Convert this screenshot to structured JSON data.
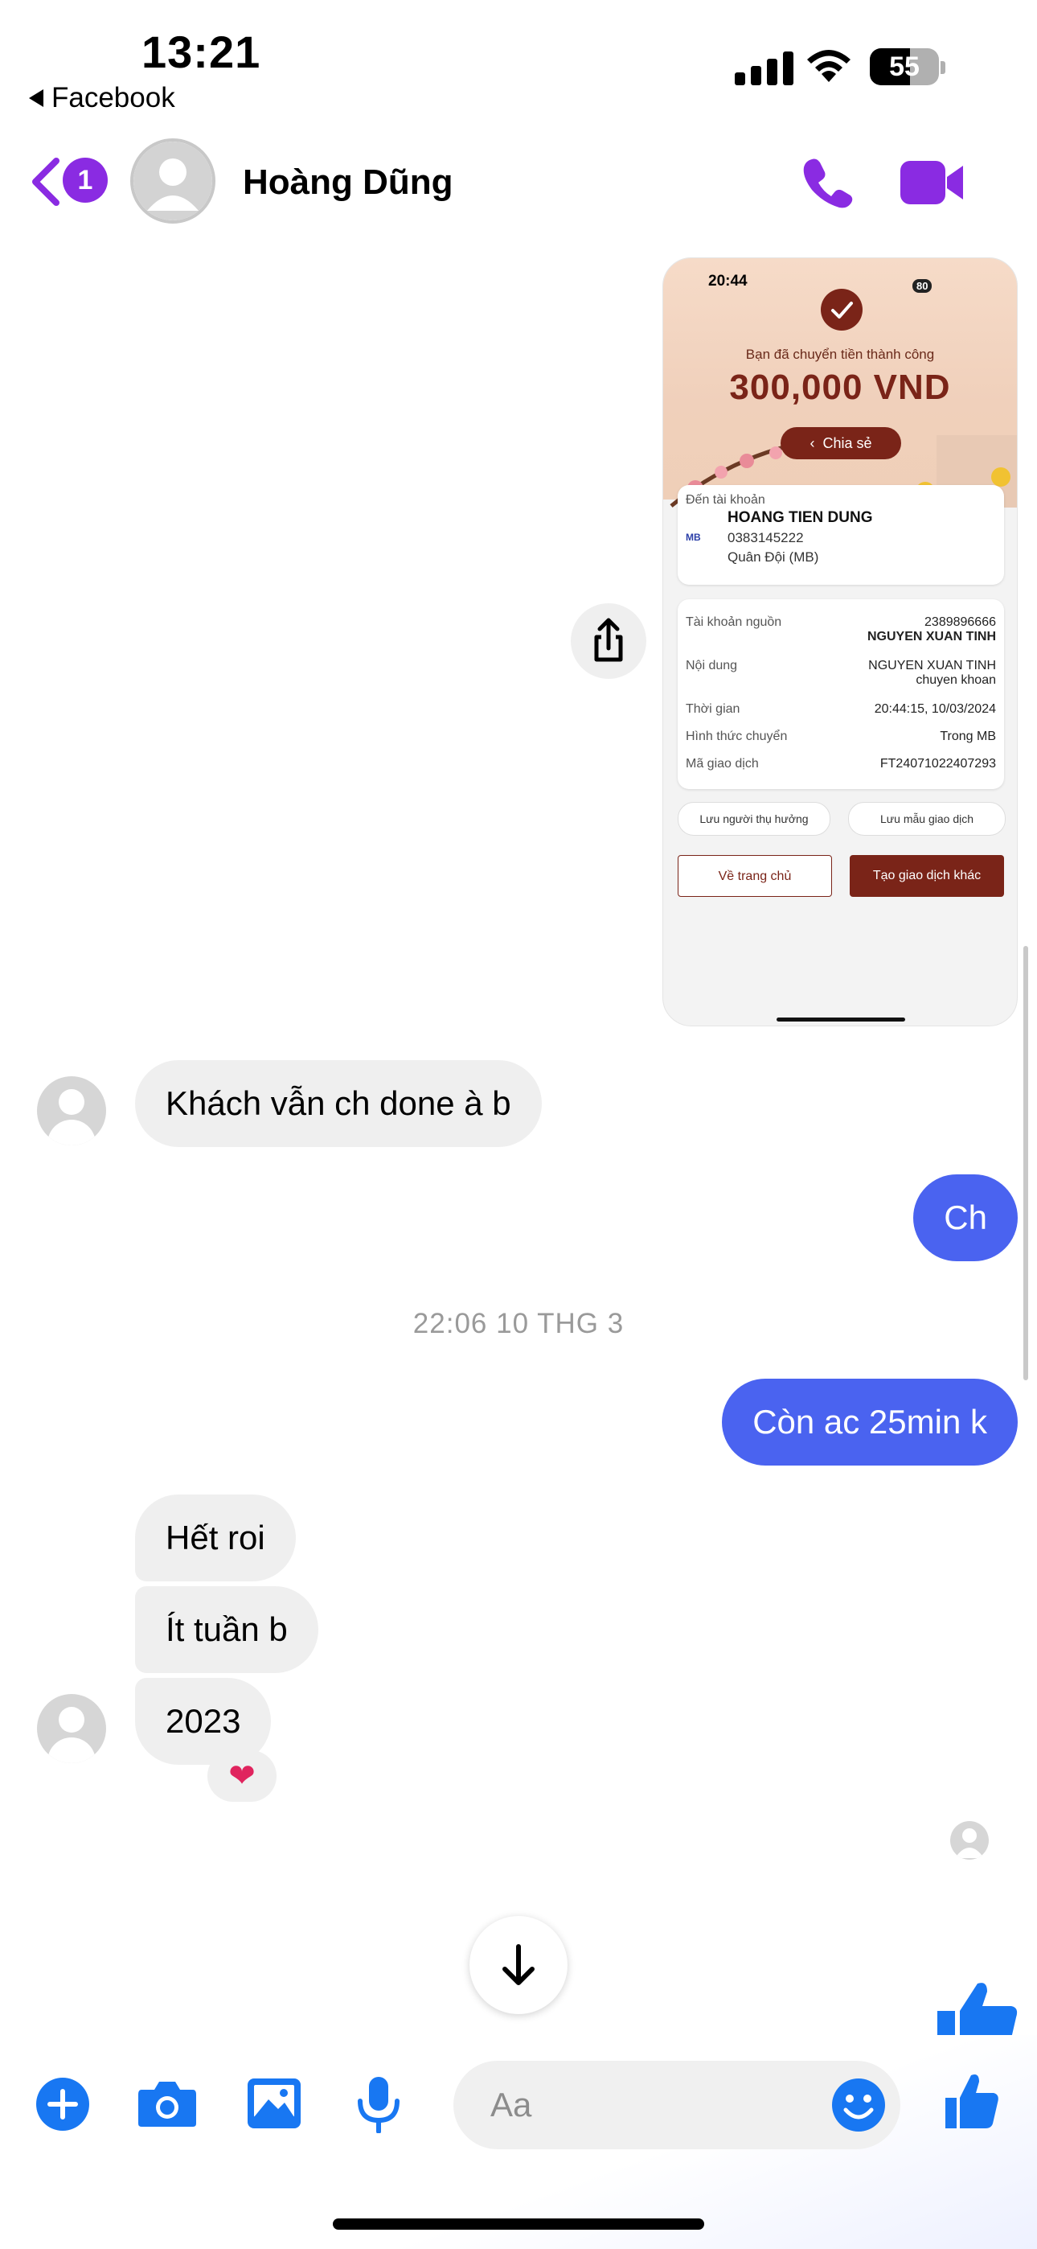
{
  "status_bar": {
    "time": "13:21",
    "back_app": "Facebook",
    "battery": "55"
  },
  "header": {
    "unread_count": "1",
    "contact_name": "Hoàng Dũng"
  },
  "shared_image": {
    "time": "20:44",
    "battery": "80",
    "title": "Bạn đã chuyển tiền thành công",
    "amount": "300,000 VND",
    "share_label": "Chia sẻ",
    "to_account_label": "Đến tài khoản",
    "bank_logo": "MB",
    "recipient_name": "HOANG TIEN DUNG",
    "recipient_account": "0383145222",
    "recipient_bank": "Quân Đội (MB)",
    "details": [
      {
        "label": "Tài khoản nguồn",
        "value": "2389896666",
        "value2": "NGUYEN XUAN TINH"
      },
      {
        "label": "Nội dung",
        "value": "NGUYEN XUAN TINH",
        "value2": "chuyen khoan"
      },
      {
        "label": "Thời gian",
        "value": "20:44:15, 10/03/2024"
      },
      {
        "label": "Hình thức chuyển",
        "value": "Trong MB"
      },
      {
        "label": "Mã giao dịch",
        "value": "FT24071022407293"
      }
    ],
    "save_recipient": "Lưu người thụ hưởng",
    "save_template": "Lưu mẫu giao dịch",
    "home_button": "Về trang chủ",
    "new_transaction_button": "Tạo giao dịch khác"
  },
  "messages": {
    "m1": "Khách vẫn ch done à b",
    "m2": "Ch",
    "timestamp": "22:06 10 THG 3",
    "m3": "Còn ac 25min k",
    "m4": "Hết roi",
    "m5": "Ít tuần b",
    "m6": "2023",
    "reaction": "❤"
  },
  "composer": {
    "placeholder": "Aa"
  },
  "colors": {
    "accent": "#8a2be2",
    "outgoing_bubble": "#4a63f0",
    "messenger_blue": "#1877f2"
  }
}
